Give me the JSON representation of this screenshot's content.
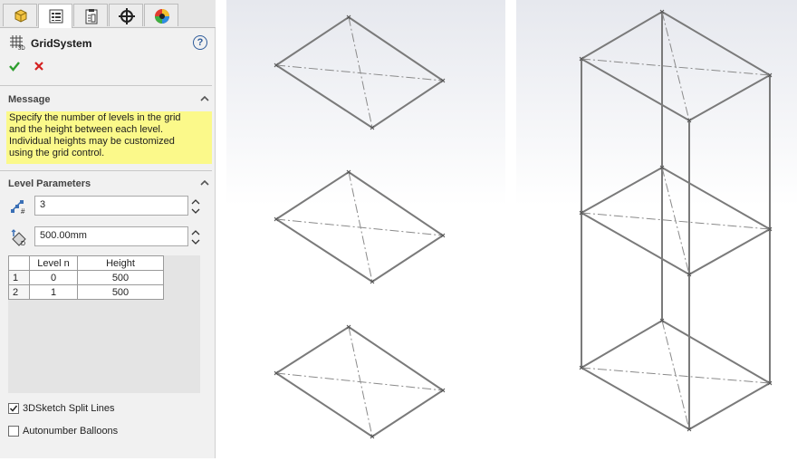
{
  "feature": {
    "title": "GridSystem"
  },
  "tabs": [
    {
      "icon": "feature-manager-icon"
    },
    {
      "icon": "property-manager-icon"
    },
    {
      "icon": "configuration-manager-icon"
    },
    {
      "icon": "dimxpert-icon"
    },
    {
      "icon": "display-manager-icon"
    }
  ],
  "message": {
    "heading": "Message",
    "lines": [
      "Specify the number of levels in the grid",
      "and the height between each level.",
      "Individual heights may be customized",
      "using the grid control."
    ]
  },
  "level_parameters": {
    "heading": "Level Parameters",
    "num_levels": "3",
    "height": "500.00mm",
    "table": {
      "columns": [
        "Level n",
        "Height"
      ],
      "rows": [
        {
          "index": "1",
          "level": "0",
          "height": "500"
        },
        {
          "index": "2",
          "level": "1",
          "height": "500"
        }
      ]
    }
  },
  "options": {
    "split_lines": {
      "label": "3DSketch Split Lines",
      "checked": true
    },
    "autonumber": {
      "label": "Autonumber Balloons",
      "checked": false
    }
  },
  "colors": {
    "message_bg": "#fbf98a",
    "ok": "#2e9e2e",
    "cancel": "#d42020",
    "sketch_line": "#7a7a7a"
  }
}
